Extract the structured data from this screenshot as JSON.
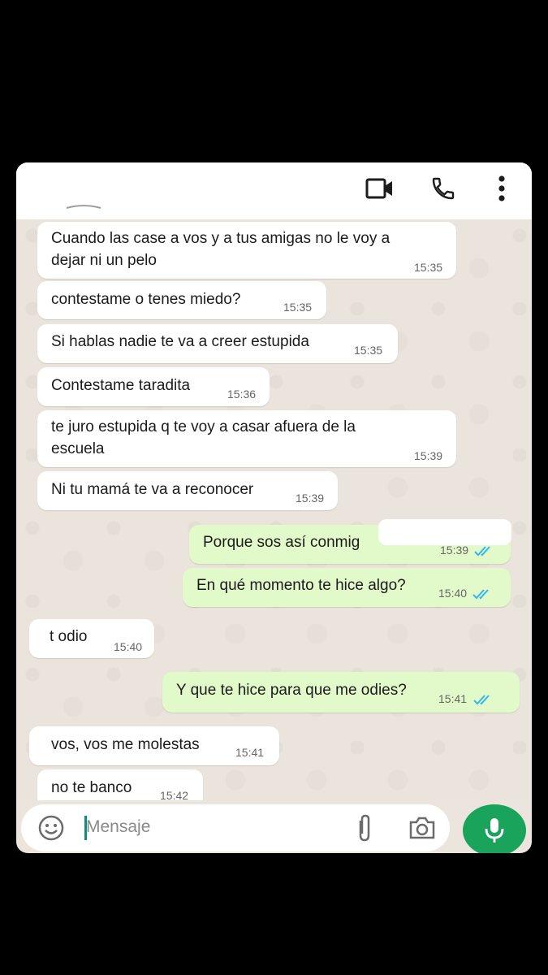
{
  "header": {
    "video_icon": "video-call-icon",
    "call_icon": "phone-call-icon",
    "menu_icon": "more-vertical-icon"
  },
  "messages": [
    {
      "dir": "in",
      "line1": "Cuando las case a vos y a tus amigas no le voy a",
      "line2": "dejar ni un pelo",
      "time": "15:35"
    },
    {
      "dir": "in",
      "line1": "contestame o tenes miedo?",
      "time": "15:35"
    },
    {
      "dir": "in",
      "line1": "Si hablas nadie te va a creer estupida",
      "time": "15:35"
    },
    {
      "dir": "in",
      "line1": "Contestame taradita",
      "time": "15:36"
    },
    {
      "dir": "in",
      "line1": "te juro estupida q te voy a casar afuera de la",
      "line2": "escuela",
      "time": "15:39"
    },
    {
      "dir": "in",
      "line1": "Ni tu mamá te va a reconocer",
      "time": "15:39"
    },
    {
      "dir": "out",
      "line1": "Porque sos así conmig",
      "time": "15:39",
      "status": "read"
    },
    {
      "dir": "out",
      "line1": "En qué momento te hice algo?",
      "time": "15:40",
      "status": "read"
    },
    {
      "dir": "in",
      "line1": "t odio",
      "time": "15:40"
    },
    {
      "dir": "out",
      "line1": "Y que te hice para que me odies?",
      "time": "15:41",
      "status": "read"
    },
    {
      "dir": "in",
      "line1": "vos, vos me molestas",
      "time": "15:41"
    },
    {
      "dir": "in",
      "line1": "no te banco",
      "time": "15:42"
    }
  ],
  "composer": {
    "placeholder": "Mensaje",
    "emoji_icon": "emoji-icon",
    "attach_icon": "paperclip-icon",
    "camera_icon": "camera-icon",
    "mic_icon": "microphone-icon"
  },
  "colors": {
    "incoming": "#ffffff",
    "outgoing": "#e2f9c9",
    "read_ticks": "#34b7f1",
    "mic_button": "#1aa35a",
    "caret": "#128c7e"
  }
}
